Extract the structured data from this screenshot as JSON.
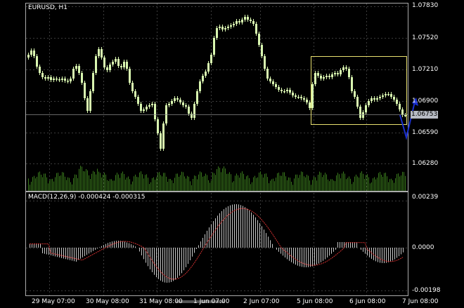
{
  "main_panel": {
    "title": "EURUSD, H1",
    "current_price": "1.06753",
    "price_ticks": [
      "1.07830",
      "1.07520",
      "1.07210",
      "1.06900",
      "1.06590",
      "1.06280"
    ]
  },
  "macd_panel": {
    "title": "MACD(12,26,9) -0.000424 -0.000315",
    "value_ticks": [
      "0.00239",
      "0.0000",
      "-0.00198"
    ]
  },
  "time_ticks": [
    "29 May 07:00",
    "30 May 08:00",
    "31 May 08:00",
    "1 Jun 07:00",
    "2 Jun 07:00",
    "5 Jun 08:00",
    "6 Jun 08:00",
    "7 Jun 08:00"
  ],
  "colors": {
    "background": "#000000",
    "candle": "#d9f7b0",
    "volume": "#3a7a1c",
    "macd_histogram": "#c8c8c8",
    "macd_signal": "#d03030",
    "selection_box": "#e8e070",
    "arrow": "#1a2fd0",
    "grid": "#3c3c3c"
  },
  "icons": [
    "price-arrow-up-icon",
    "price-arrow-down-icon"
  ]
}
